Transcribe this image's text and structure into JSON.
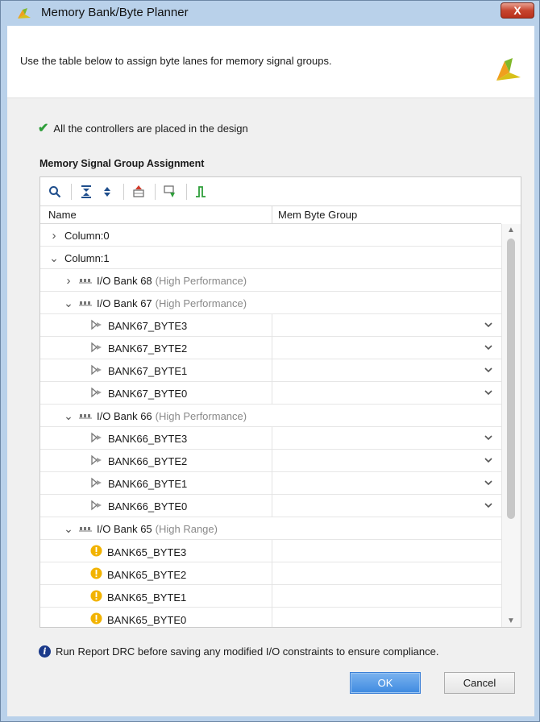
{
  "window": {
    "title": "Memory Bank/Byte Planner",
    "close_label": "X"
  },
  "header": {
    "text": "Use the table below to assign byte lanes for memory signal groups."
  },
  "status": {
    "text": "All the controllers are placed in the design"
  },
  "section": {
    "title": "Memory Signal Group Assignment"
  },
  "toolbar": {
    "icons": [
      "search-icon",
      "collapse-all-icon",
      "expand-all-icon",
      "auto-place-icon",
      "fix-icon",
      "signal-icon"
    ]
  },
  "grid": {
    "columns": [
      "Name",
      "Mem Byte Group"
    ],
    "rows": [
      {
        "level": 0,
        "toggle": ">",
        "label": "Column:0",
        "sub": ""
      },
      {
        "level": 0,
        "toggle": "v",
        "label": "Column:1",
        "sub": ""
      },
      {
        "level": 1,
        "toggle": ">",
        "icon": "bank",
        "label": "I/O Bank 68",
        "sub": "(High Performance)"
      },
      {
        "level": 1,
        "toggle": "v",
        "icon": "bank",
        "label": "I/O Bank 67",
        "sub": "(High Performance)"
      },
      {
        "level": 2,
        "icon": "byte",
        "label": "BANK67_BYTE3",
        "dropdown": true
      },
      {
        "level": 2,
        "icon": "byte",
        "label": "BANK67_BYTE2",
        "dropdown": true
      },
      {
        "level": 2,
        "icon": "byte",
        "label": "BANK67_BYTE1",
        "dropdown": true
      },
      {
        "level": 2,
        "icon": "byte",
        "label": "BANK67_BYTE0",
        "dropdown": true
      },
      {
        "level": 1,
        "toggle": "v",
        "icon": "bank",
        "label": "I/O Bank 66",
        "sub": "(High Performance)"
      },
      {
        "level": 2,
        "icon": "byte",
        "label": "BANK66_BYTE3",
        "dropdown": true
      },
      {
        "level": 2,
        "icon": "byte",
        "label": "BANK66_BYTE2",
        "dropdown": true
      },
      {
        "level": 2,
        "icon": "byte",
        "label": "BANK66_BYTE1",
        "dropdown": true
      },
      {
        "level": 2,
        "icon": "byte",
        "label": "BANK66_BYTE0",
        "dropdown": true
      },
      {
        "level": 1,
        "toggle": "v",
        "icon": "bank",
        "label": "I/O Bank 65",
        "sub": "(High Range)"
      },
      {
        "level": 2,
        "icon": "warn",
        "label": "BANK65_BYTE3"
      },
      {
        "level": 2,
        "icon": "warn",
        "label": "BANK65_BYTE2"
      },
      {
        "level": 2,
        "icon": "warn",
        "label": "BANK65_BYTE1"
      },
      {
        "level": 2,
        "icon": "warn",
        "label": "BANK65_BYTE0"
      }
    ]
  },
  "info": {
    "text": "Run Report DRC before saving any modified I/O constraints to ensure compliance."
  },
  "buttons": {
    "ok": "OK",
    "cancel": "Cancel"
  },
  "colors": {
    "frame": "#b9d1ea",
    "ok_button": "#3e8ae0",
    "success": "#2e9e3a",
    "warning": "#f2b300"
  }
}
